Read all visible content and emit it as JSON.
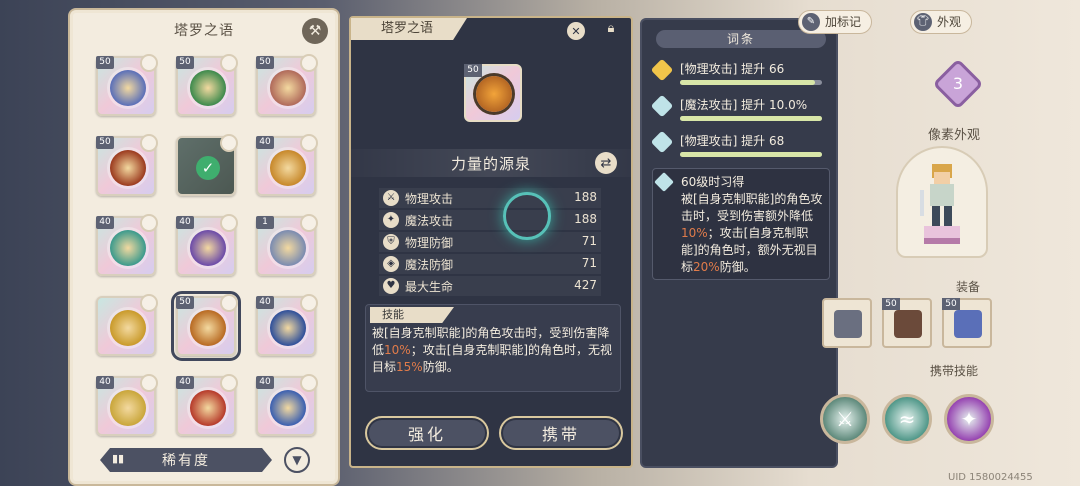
{
  "left_panel": {
    "title": "塔罗之语",
    "hammer_icon": "hammer-icon",
    "cards": [
      {
        "level": "50",
        "color": "#5a6fb8"
      },
      {
        "level": "50",
        "color": "#3d8a4c"
      },
      {
        "level": "50",
        "color": "#b06a5a"
      },
      {
        "level": "50",
        "color": "#9b3a1e"
      },
      {
        "level": "",
        "color": "#4c5852",
        "equipped": true
      },
      {
        "level": "40",
        "color": "#c7882a"
      },
      {
        "level": "40",
        "color": "#3b9a8c"
      },
      {
        "level": "40",
        "color": "#6b4aa8"
      },
      {
        "level": "1",
        "color": "#7a8bb0"
      },
      {
        "level": "",
        "color": "#c99a2a"
      },
      {
        "level": "50",
        "color": "#b86a22"
      },
      {
        "level": "40",
        "color": "#2e4f9a"
      },
      {
        "level": "40",
        "color": "#c9a63a"
      },
      {
        "level": "40",
        "color": "#b63a2a"
      },
      {
        "level": "40",
        "color": "#3a5fb0"
      }
    ],
    "rarity_label": "稀有度",
    "rarity_icon": "bars-icon",
    "filter_icon": "funnel-icon"
  },
  "detail": {
    "tab_title": "塔罗之语",
    "close_icon": "close-icon",
    "lock_icon": "lock-icon",
    "card_level": "50",
    "card_name": "力量的源泉",
    "swap_icon": "swap-icon",
    "stats": [
      {
        "label": "物理攻击",
        "value": "188",
        "icon": "sword-icon"
      },
      {
        "label": "魔法攻击",
        "value": "188",
        "icon": "wand-icon"
      },
      {
        "label": "物理防御",
        "value": "71",
        "icon": "shield-icon"
      },
      {
        "label": "魔法防御",
        "value": "71",
        "icon": "magic-shield-icon"
      },
      {
        "label": "最大生命",
        "value": "427",
        "icon": "heart-icon"
      }
    ],
    "skill_tag": "技能",
    "skill_text_1": "被[自身克制职能]的角色攻击时，受到伤害降低",
    "skill_hl_1": "10%",
    "skill_text_2": "；攻击[自身克制职能]的角色时，无视目标",
    "skill_hl_2": "15%",
    "skill_text_3": "防御。",
    "enhance_label": "强化",
    "carry_label": "携带"
  },
  "affix": {
    "title": "词条",
    "rows": [
      {
        "text": "[物理攻击] 提升 66",
        "fill": 0.95,
        "gem_color": "#f0c44a"
      },
      {
        "text": "[魔法攻击] 提升 10.0%",
        "fill": 1.0,
        "gem_color": "#bfe3e8"
      },
      {
        "text": "[物理攻击] 提升 68",
        "fill": 1.0,
        "gem_color": "#bfe3e8"
      }
    ],
    "learn_title": "60级时习得",
    "learn_text_1": "被[自身克制职能]的角色攻击时，受到伤害额外降低",
    "learn_hl_1": "10%",
    "learn_text_2": "；攻击[自身克制职能]的角色时，额外无视目标",
    "learn_hl_2": "20%",
    "learn_text_3": "防御。"
  },
  "right": {
    "mark_label": "加标记",
    "appearance_label": "外观",
    "level_badge": "3",
    "pixel_label": "像素外观",
    "equip_label": "装备",
    "equip_slots": [
      {
        "level": "",
        "color": "#6a6f80"
      },
      {
        "level": "50",
        "color": "#6b4a3a"
      },
      {
        "level": "50",
        "color": "#5a6fb8"
      }
    ],
    "skills_label": "携带技能",
    "skill_orbs": [
      {
        "icon": "sword-aura-icon",
        "color": "#4a7a6a"
      },
      {
        "icon": "wave-icon",
        "color": "#3a8a7a"
      },
      {
        "icon": "figure-icon",
        "color": "#8a2aa8"
      }
    ],
    "uid": "UID 1580024455"
  }
}
